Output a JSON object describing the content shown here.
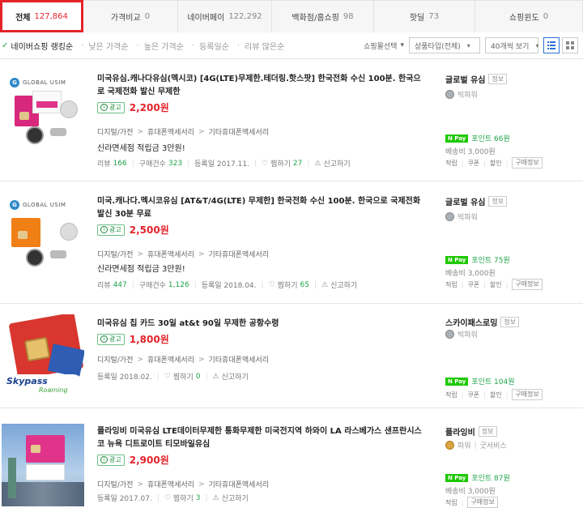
{
  "tabs": [
    {
      "label": "전체",
      "count": "127,864"
    },
    {
      "label": "가격비교",
      "count": "0"
    },
    {
      "label": "네이버페이",
      "count": "122,292"
    },
    {
      "label": "백화점/홈쇼핑",
      "count": "98"
    },
    {
      "label": "핫딜",
      "count": "73"
    },
    {
      "label": "쇼핑윈도",
      "count": "0"
    }
  ],
  "sort": {
    "options": [
      "네이버쇼핑 랭킹순",
      "낮은 가격순",
      "높은 가격순",
      "등록일순",
      "리뷰 많은순"
    ],
    "mall_select_label": "쇼핑몰선택",
    "type_select": "상품타입(전체)",
    "per_page_select": "40개씩 보기"
  },
  "items": [
    {
      "title": "미국유심.캐나다유심(멕시코) [4G(LTE)무제한.테더링.핫스팟] 한국전화 수신 100분. 한국으로 국제전화 발신 무제한",
      "ad": "광고",
      "price": "2,200원",
      "cats": [
        "디지털/가전",
        "휴대폰액세서리",
        "기타휴대폰액세서리"
      ],
      "promo": "신라면세점 적립금 3만원!",
      "review_label": "리뷰",
      "review_count": "166",
      "buy_label": "구매건수",
      "buy_count": "323",
      "date": "등록일 2017.11.",
      "wish_label": "찜하기",
      "wish_count": "27",
      "report": "신고하기",
      "mall": "글로벌 유심",
      "mall_info": "정보",
      "grade": "빅파워",
      "npay_points": "포인트 66원",
      "shipping": "배송비 3,000원",
      "tags": [
        "적립",
        "쿠폰",
        "할인",
        "구매정보"
      ]
    },
    {
      "title": "미국.캐나다.멕시코유심 [AT&T/4G(LTE) 무제한] 한국전화 수신 100분. 한국으로 국제전화 발신 30분 무료",
      "ad": "광고",
      "price": "2,500원",
      "cats": [
        "디지털/가전",
        "휴대폰액세서리",
        "기타휴대폰액세서리"
      ],
      "promo": "신라면세점 적립금 3만원!",
      "review_label": "리뷰",
      "review_count": "447",
      "buy_label": "구매건수",
      "buy_count": "1,126",
      "date": "등록일 2018.04.",
      "wish_label": "찜하기",
      "wish_count": "65",
      "report": "신고하기",
      "mall": "글로벌 유심",
      "mall_info": "정보",
      "grade": "빅파워",
      "npay_points": "포인트 75원",
      "shipping": "배송비 3,000원",
      "tags": [
        "적립",
        "쿠폰",
        "할인",
        "구매정보"
      ]
    },
    {
      "title": "미국유심 칩 카드 30일 at&t 90일 무제한 공항수령",
      "ad": "광고",
      "price": "1,800원",
      "cats": [
        "디지털/가전",
        "휴대폰액세서리",
        "기타휴대폰액세서리"
      ],
      "date": "등록일 2018.02.",
      "wish_label": "찜하기",
      "wish_count": "0",
      "report": "신고하기",
      "mall": "스카이패스로밍",
      "mall_info": "정보",
      "grade": "빅파워",
      "npay_points": "포인트 104원",
      "tags": [
        "적립",
        "쿠폰",
        "할인",
        "구매정보"
      ]
    },
    {
      "title": "플라잉비 미국유심 LTE데이터무제한 통화무제한 미국전지역 하와이 LA 라스베가스 샌프란시스코 뉴욕 디트로이트 티모바일유심",
      "ad": "광고",
      "price": "2,900원",
      "cats": [
        "디지털/가전",
        "휴대폰액세서리",
        "기타휴대폰액세서리"
      ],
      "date": "등록일 2017.07.",
      "wish_label": "찜하기",
      "wish_count": "3",
      "report": "신고하기",
      "mall": "플라잉비",
      "mall_info": "정보",
      "grade": "파워",
      "grade2": "굿서비스",
      "npay_points": "포인트 87원",
      "shipping": "배송비 3,000원",
      "tags": [
        "적립",
        "구매정보"
      ]
    }
  ],
  "thumb_text": {
    "global_usim": "GLOBAL USIM",
    "skypass": "Skypass",
    "roaming": "Roaming"
  },
  "colors": {
    "accent_red": "#e3242b",
    "naver_green": "#1ec800",
    "point_green": "#1ea44a"
  }
}
